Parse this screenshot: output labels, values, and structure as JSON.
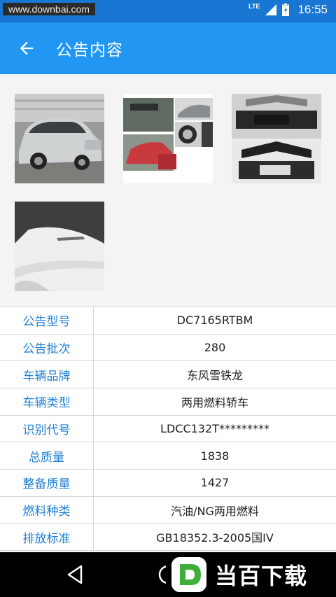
{
  "status_bar": {
    "watermark": "www.downbai.com",
    "network": "LTE",
    "time": "16:55"
  },
  "app_bar": {
    "title": "公告内容",
    "back_icon": "arrow-left-icon"
  },
  "photos": [
    {
      "name": "car-front-side-photo"
    },
    {
      "name": "car-details-collage-photo"
    },
    {
      "name": "car-grille-photo"
    },
    {
      "name": "car-side-badge-photo"
    }
  ],
  "info": [
    {
      "label": "公告型号",
      "value": "DC7165RTBM"
    },
    {
      "label": "公告批次",
      "value": "280"
    },
    {
      "label": "车辆品牌",
      "value": "东风雪铁龙"
    },
    {
      "label": "车辆类型",
      "value": "两用燃料轿车"
    },
    {
      "label": "识别代号",
      "value": "LDCC132T*********"
    },
    {
      "label": "总质量",
      "value": "1838"
    },
    {
      "label": "整备质量",
      "value": "1427"
    },
    {
      "label": "燃料种类",
      "value": "汽油/NG两用燃料"
    },
    {
      "label": "排放标准",
      "value": "GB18352.3-2005国IV"
    }
  ],
  "bottom_watermark": {
    "text": "当百下载"
  },
  "colors": {
    "status_bar": "#1976d2",
    "app_bar": "#2196f3",
    "label_text": "#1e7fd6"
  }
}
